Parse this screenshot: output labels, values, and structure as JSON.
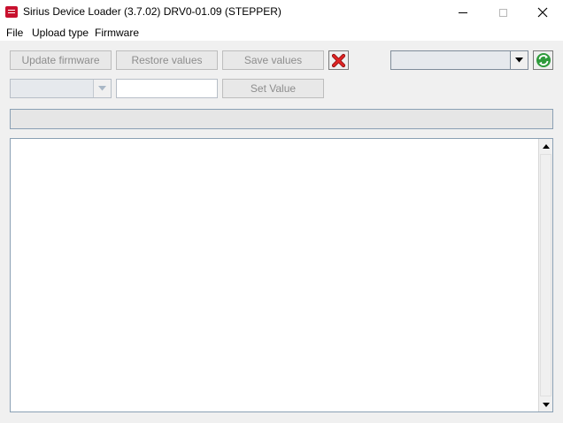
{
  "window": {
    "title": "Sirius Device Loader (3.7.02) DRV0-01.09  (STEPPER)",
    "icon": "app-loader-icon",
    "controls": [
      "minimize-icon",
      "maximize-icon",
      "close-icon"
    ]
  },
  "menu": {
    "file": "File",
    "upload_type": "Upload type",
    "firmware": "Firmware"
  },
  "toolbar": {
    "update_firmware": "Update firmware",
    "restore_values": "Restore values",
    "save_values": "Save values",
    "cancel_icon": "red-x-icon",
    "port_value": "",
    "refresh_icon": "refresh-icon"
  },
  "params": {
    "selected": "",
    "value": "",
    "set_value": "Set Value"
  },
  "progress": {
    "value_percent": 0
  },
  "log": {
    "text": ""
  },
  "colors": {
    "accent_red": "#c8102e",
    "refresh_green": "#2e9a3a",
    "disabled_text": "#8d8d8d"
  }
}
